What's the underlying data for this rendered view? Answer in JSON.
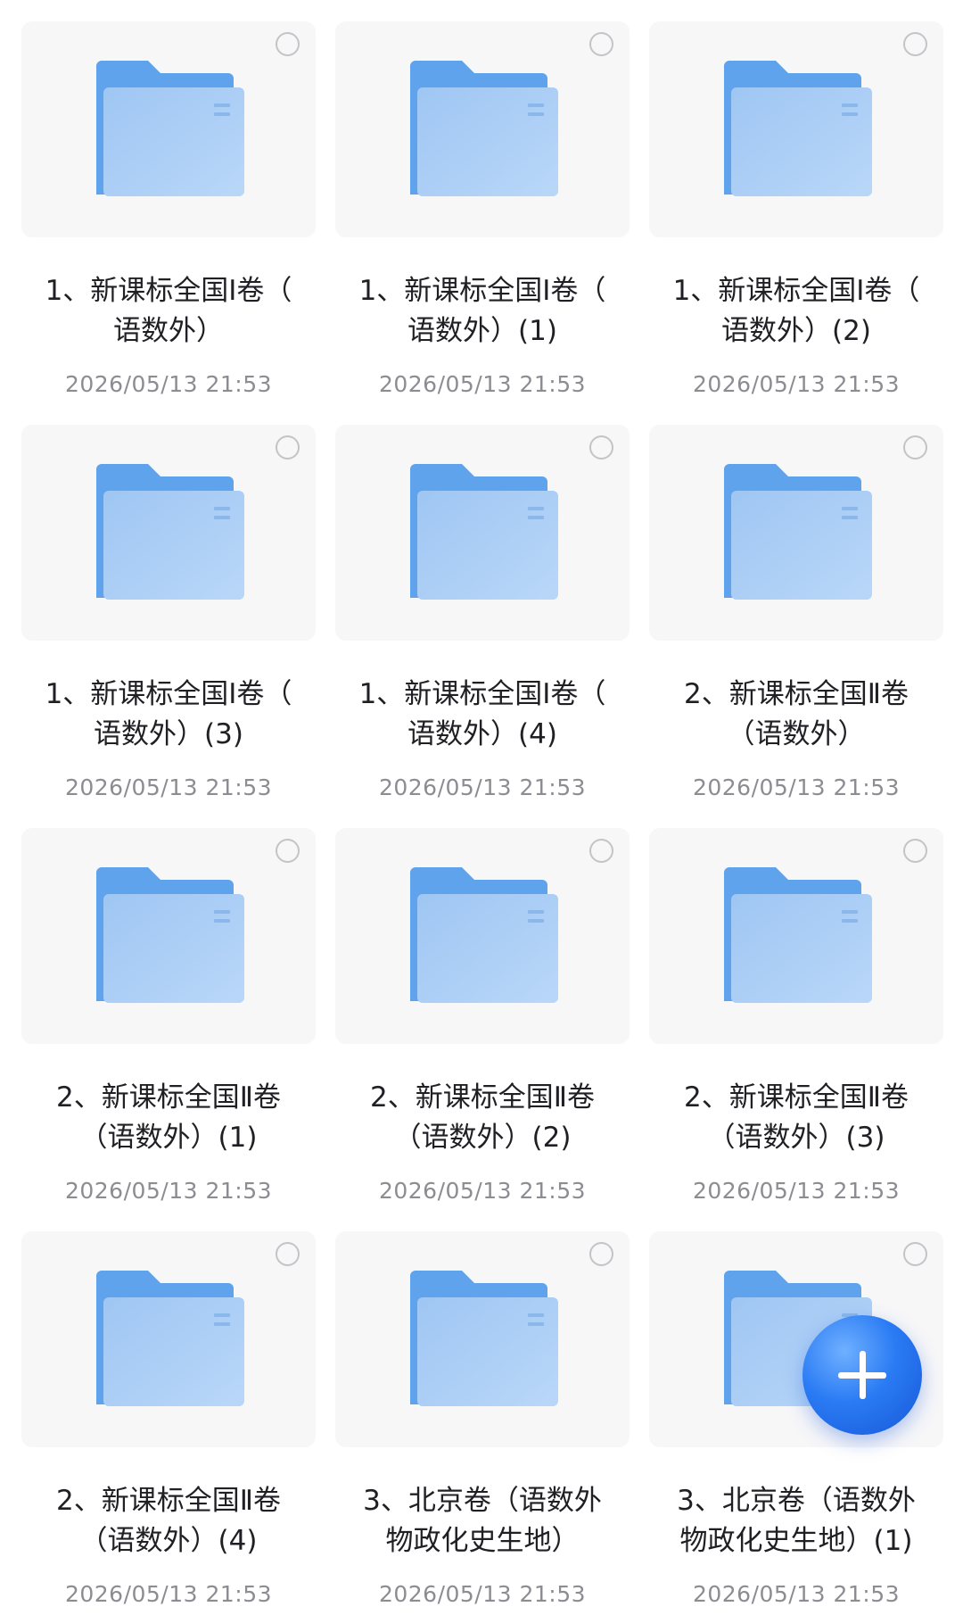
{
  "folders": [
    {
      "name": "1、新课标全国Ⅰ卷（\n语数外）",
      "date": "2026/05/13 21:53"
    },
    {
      "name": "1、新课标全国Ⅰ卷（\n语数外）(1)",
      "date": "2026/05/13 21:53"
    },
    {
      "name": "1、新课标全国Ⅰ卷（\n语数外）(2)",
      "date": "2026/05/13 21:53"
    },
    {
      "name": "1、新课标全国Ⅰ卷（\n语数外）(3)",
      "date": "2026/05/13 21:53"
    },
    {
      "name": "1、新课标全国Ⅰ卷（\n语数外）(4)",
      "date": "2026/05/13 21:53"
    },
    {
      "name": "2、新课标全国Ⅱ卷\n（语数外）",
      "date": "2026/05/13 21:53"
    },
    {
      "name": "2、新课标全国Ⅱ卷\n（语数外）(1)",
      "date": "2026/05/13 21:53"
    },
    {
      "name": "2、新课标全国Ⅱ卷\n（语数外）(2)",
      "date": "2026/05/13 21:53"
    },
    {
      "name": "2、新课标全国Ⅱ卷\n（语数外）(3)",
      "date": "2026/05/13 21:53"
    },
    {
      "name": "2、新课标全国Ⅱ卷\n（语数外）(4)",
      "date": "2026/05/13 21:53"
    },
    {
      "name": "3、北京卷（语数外\n物政化史生地）",
      "date": "2026/05/13 21:53"
    },
    {
      "name": "3、北京卷（语数外\n物政化史生地）(1)",
      "date": "2026/05/13 21:53"
    }
  ],
  "icons": {
    "folder": "folder-icon",
    "select": "select-circle-icon",
    "add": "plus-icon"
  },
  "colors": {
    "folder_back": "#5ea3ec",
    "folder_front": "#a9cdf6",
    "fab": "#2a7bf4"
  }
}
